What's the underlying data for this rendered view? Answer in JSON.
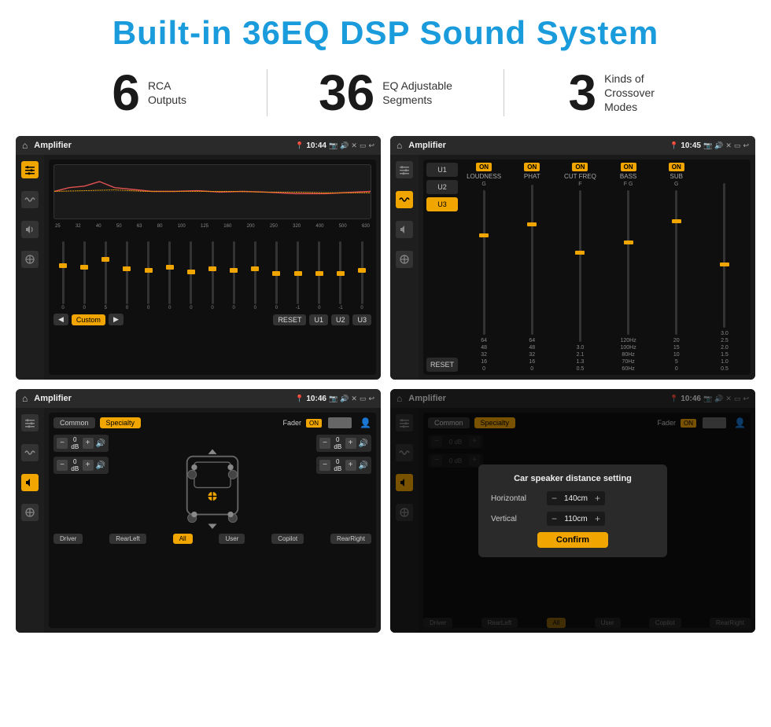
{
  "header": {
    "title": "Built-in 36EQ DSP Sound System"
  },
  "stats": [
    {
      "number": "6",
      "label": "RCA\nOutputs"
    },
    {
      "number": "36",
      "label": "EQ Adjustable\nSegments"
    },
    {
      "number": "3",
      "label": "Kinds of\nCrossover Modes"
    }
  ],
  "screens": [
    {
      "id": "eq-screen",
      "statusBar": {
        "title": "Amplifier",
        "time": "10:44"
      },
      "type": "eq"
    },
    {
      "id": "crossover-screen",
      "statusBar": {
        "title": "Amplifier",
        "time": "10:45"
      },
      "type": "crossover"
    },
    {
      "id": "fader-screen",
      "statusBar": {
        "title": "Amplifier",
        "time": "10:46"
      },
      "type": "fader"
    },
    {
      "id": "dialog-screen",
      "statusBar": {
        "title": "Amplifier",
        "time": "10:46"
      },
      "type": "dialog"
    }
  ],
  "eq": {
    "frequencies": [
      "25",
      "32",
      "40",
      "50",
      "63",
      "80",
      "100",
      "125",
      "160",
      "200",
      "250",
      "320",
      "400",
      "500",
      "630"
    ],
    "values": [
      "0",
      "0",
      "5",
      "0",
      "0",
      "0",
      "0",
      "0",
      "0",
      "0",
      "0",
      "-1",
      "0",
      "-1"
    ],
    "bottomButtons": [
      "◀",
      "Custom",
      "▶",
      "RESET",
      "U1",
      "U2",
      "U3"
    ]
  },
  "crossover": {
    "modes": [
      "U1",
      "U2",
      "U3"
    ],
    "channels": [
      {
        "label": "LOUDNESS",
        "on": true
      },
      {
        "label": "PHAT",
        "on": true
      },
      {
        "label": "CUT FREQ",
        "on": true
      },
      {
        "label": "BASS",
        "on": true
      },
      {
        "label": "SUB",
        "on": true
      }
    ],
    "resetLabel": "RESET"
  },
  "fader": {
    "tabs": [
      "Common",
      "Specialty"
    ],
    "faderLabel": "Fader",
    "toggleLabel": "ON",
    "volumes": [
      {
        "label": "0 dB"
      },
      {
        "label": "0 dB"
      },
      {
        "label": "0 dB"
      },
      {
        "label": "0 dB"
      }
    ],
    "bottomButtons": [
      "Driver",
      "RearLeft",
      "All",
      "User",
      "Copilot",
      "RearRight"
    ]
  },
  "dialog": {
    "title": "Car speaker distance setting",
    "rows": [
      {
        "label": "Horizontal",
        "value": "140cm"
      },
      {
        "label": "Vertical",
        "value": "110cm"
      }
    ],
    "confirmLabel": "Confirm",
    "tabs": [
      "Common",
      "Specialty"
    ],
    "faderLabel": "Fader",
    "toggleLabel": "ON",
    "bottomButtons": [
      "Driver",
      "RearLeft",
      "All",
      "User",
      "Copilot",
      "RearRight"
    ]
  },
  "colors": {
    "accent": "#f0a500",
    "headerBlue": "#1a9bdc",
    "bg": "#1a1a1a",
    "statusBg": "#2a2a2a"
  }
}
